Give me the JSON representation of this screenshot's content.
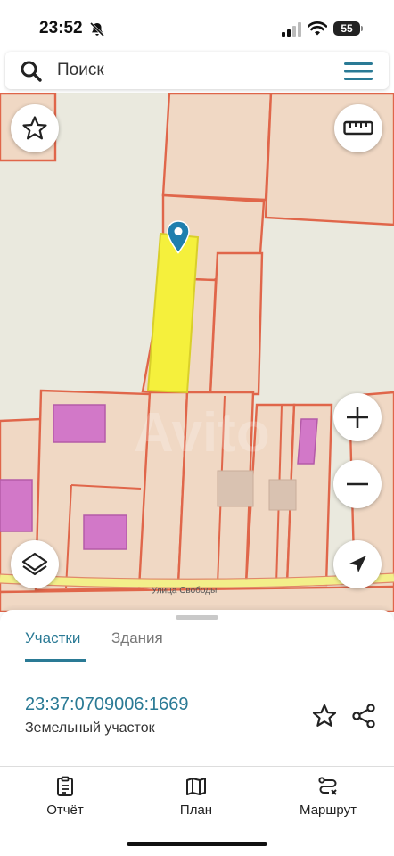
{
  "status_bar": {
    "time": "23:52",
    "battery": "55",
    "icons": [
      "bell-off-icon",
      "signal-icon",
      "wifi-icon",
      "battery-icon"
    ]
  },
  "search": {
    "placeholder": "Поиск",
    "icons": [
      "search-icon",
      "menu-icon"
    ]
  },
  "map": {
    "street_name": "Улица Свободы",
    "watermark": "Avito",
    "colors": {
      "parcel_fill": "#f0d8c4",
      "parcel_border": "#e0664a",
      "selected_parcel": "#f5f03c",
      "building": "#d278c8",
      "pin": "#1f7fae",
      "road": "#f3ef8a"
    },
    "controls": [
      "favorite-star-icon",
      "ruler-icon",
      "zoom-in-icon",
      "zoom-out-icon",
      "layers-icon",
      "locate-arrow-icon"
    ]
  },
  "panel": {
    "tabs": [
      {
        "label": "Участки",
        "active": true
      },
      {
        "label": "Здания",
        "active": false
      }
    ],
    "parcel": {
      "cadastral_number": "23:37:0709006:1669",
      "type": "Земельный участок"
    },
    "bottom_nav": [
      {
        "label": "Отчёт",
        "icon": "report-icon"
      },
      {
        "label": "План",
        "icon": "map-icon"
      },
      {
        "label": "Маршрут",
        "icon": "route-icon"
      }
    ],
    "accent": "#2a7a95"
  }
}
